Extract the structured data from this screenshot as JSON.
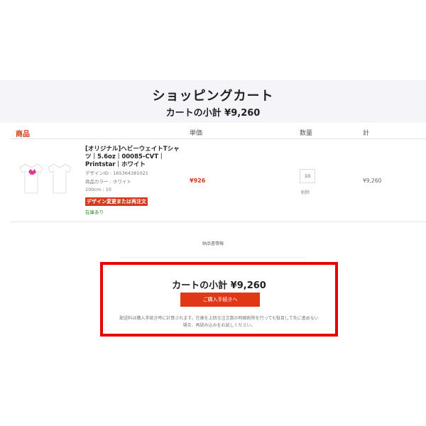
{
  "header": {
    "title": "ショッピングカート",
    "subtotal": "カートの小計 ¥9,260"
  },
  "table": {
    "columns": [
      "商品",
      "単価",
      "数量",
      "計"
    ]
  },
  "item": {
    "name": "[オリジナル]ヘビーウェイトTシャツ｜5.6oz｜00085-CVT｜Printstar｜ホワイト",
    "design_id": "デザインID : 165364381021",
    "color": "商品カラー : ホワイト",
    "size_qty": "100cm : 10",
    "badge": "デザイン変更または再注文",
    "stock": "在庫あり",
    "unit_price": "¥926",
    "quantity": "10",
    "delete_label": "削除",
    "line_total": "¥9,260"
  },
  "delivery": {
    "label": "納品書情報"
  },
  "summary": {
    "subtotal": "カートの小計 ¥9,260",
    "checkout_label": "ご購入手続きへ",
    "notice": "配送料は購入手続き時に計算されます。在庫を上回る注文数の明細削除を行っても駄目して先に進めない場合、再読み込みをお試しください。"
  },
  "colors": {
    "accent": "#e03716",
    "highlight_border": "#e60000",
    "stock_green": "#2e8b2e"
  }
}
